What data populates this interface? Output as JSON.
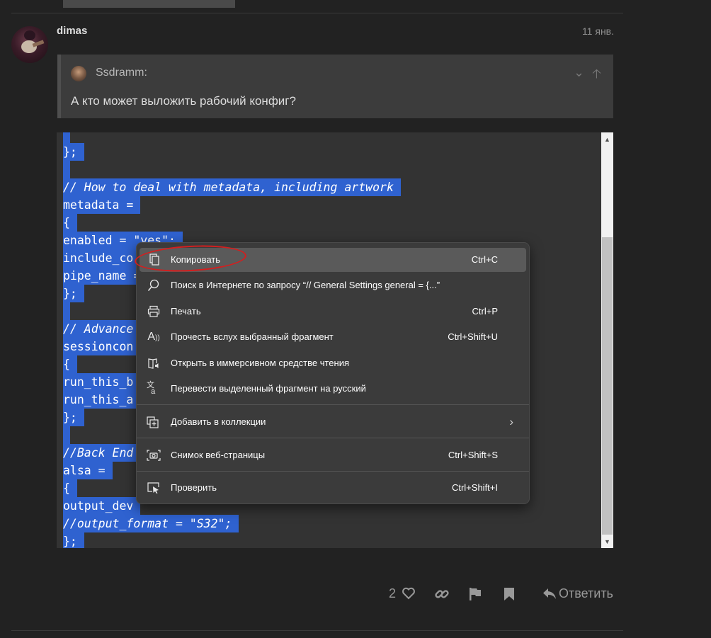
{
  "post": {
    "username": "dimas",
    "date": "11 янв.",
    "quote": {
      "author": "Ssdramm:",
      "text": "А кто может выложить рабочий конфиг?"
    }
  },
  "code_lines": [
    "",
    "};",
    "",
    "// How to deal with metadata, including artwork",
    "metadata =",
    "{",
    "enabled = \"yes\";",
    "include_co",
    "pipe_name =",
    "};",
    "",
    "// Advance",
    "sessioncon",
    "{",
    "run_this_b",
    "run_this_a",
    "};",
    "",
    "//Back End",
    "alsa =",
    "{",
    "output_dev",
    "//output_format = \"S32\";",
    "};"
  ],
  "context_menu": {
    "items": [
      {
        "label": "Копировать",
        "shortcut": "Ctrl+C",
        "icon": "copy-icon"
      },
      {
        "label": "Поиск в Интернете по запросу “// General Settings general = {...”",
        "shortcut": "",
        "icon": "search-icon"
      },
      {
        "label": "Печать",
        "shortcut": "Ctrl+P",
        "icon": "print-icon"
      },
      {
        "label": "Прочесть вслух выбранный фрагмент",
        "shortcut": "Ctrl+Shift+U",
        "icon": "read-aloud-icon"
      },
      {
        "label": "Открыть в иммерсивном средстве чтения",
        "shortcut": "",
        "icon": "immersive-reader-icon"
      },
      {
        "label": "Перевести выделенный фрагмент на русский",
        "shortcut": "",
        "icon": "translate-icon"
      },
      {
        "label": "Добавить в коллекции",
        "shortcut": "",
        "icon": "collections-icon"
      },
      {
        "label": "Снимок веб-страницы",
        "shortcut": "Ctrl+Shift+S",
        "icon": "screenshot-icon"
      },
      {
        "label": "Проверить",
        "shortcut": "Ctrl+Shift+I",
        "icon": "inspect-icon"
      }
    ]
  },
  "actions": {
    "like_count": "2",
    "reply_label": "Ответить"
  },
  "colors": {
    "background": "#222222",
    "selection": "#2f62d0",
    "menu_bg": "#3b3b3b",
    "annotation": "#d41e1e"
  }
}
